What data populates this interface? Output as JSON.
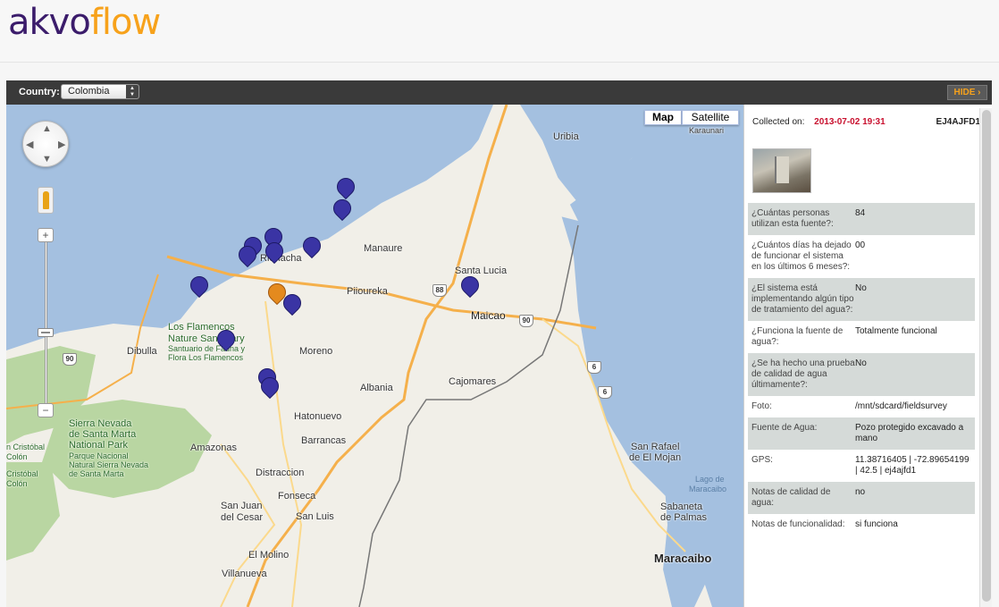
{
  "logo": {
    "part1": "akvo",
    "part2": "flow"
  },
  "toolbar": {
    "country_label": "Country:",
    "country_value": "Colombia",
    "hide_label": "HIDE ›"
  },
  "map": {
    "map_button": "Map",
    "satellite_button": "Satellite",
    "zoom_in": "+",
    "zoom_out": "−",
    "labels": {
      "uribia": "Uribia",
      "karaunari": "Karaunari",
      "manaure": "Manaure",
      "santa_lucia": "Santa Lucia",
      "riohacha": "Riohacha",
      "piioreka": "Piioureka",
      "maicao": "Maicao",
      "moreno": "Moreno",
      "dibulla": "Dibulla",
      "flamencos1": "Los Flamencos",
      "flamencos2": "Nature Sanctuary",
      "flamencos3": "Santuario de Fauna y",
      "flamencos4": "Flora Los Flamencos",
      "cajomares": "Cajomares",
      "albania": "Albania",
      "hatonuevo": "Hatonuevo",
      "barrancas": "Barrancas",
      "amazonas": "Amazonas",
      "sierra1": "Sierra Nevada",
      "sierra2": "de Santa Marta",
      "sierra3": "National Park",
      "sierra4": "Parque Nacional",
      "sierra5": "Natural Sierra Nevada",
      "sierra6": "de Santa Marta",
      "cristobal1": "n Cristóbal",
      "cristobal2": "Colón",
      "cristobal3": "Cristóbal",
      "cristobal4": "Colón",
      "distraccion": "Distraccion",
      "fonseca": "Fonseca",
      "sanjuan1": "San Juan",
      "sanjuan2": "del Cesar",
      "sanluis": "San Luis",
      "elmolino": "El Molino",
      "villanueva": "Villanueva",
      "sanrafael1": "San Rafael",
      "sanrafael2": "de El Mojan",
      "lago1": "Lago de",
      "lago2": "Maracaibo",
      "sabaneta1": "Sabaneta",
      "sabaneta2": "de Palmas",
      "maracaibo": "Maracaibo"
    },
    "shields": {
      "s88": "88",
      "s90a": "90",
      "s90b": "90",
      "s6a": "6",
      "s6b": "6"
    }
  },
  "panel": {
    "collected_label": "Collected on:",
    "collected_date": "2013-07-02 19:31",
    "code": "EJ4AJFD1",
    "rows": [
      {
        "q": "¿Cuántas personas utilizan esta fuente?:",
        "a": "84"
      },
      {
        "q": "¿Cuántos días ha dejado de funcionar el sistema en los últimos 6 meses?:",
        "a": "00"
      },
      {
        "q": "¿El sistema está implementando algún tipo de tratamiento del agua?:",
        "a": "No"
      },
      {
        "q": "¿Funciona la fuente de agua?:",
        "a": "Totalmente funcional"
      },
      {
        "q": "¿Se ha hecho una prueba de calidad de agua últimamente?:",
        "a": "No"
      },
      {
        "q": "Foto:",
        "a": "/mnt/sdcard/fieldsurvey"
      },
      {
        "q": "Fuente de Agua:",
        "a": "Pozo protegido excavado a mano"
      },
      {
        "q": "GPS:",
        "a": "11.38716405 | -72.89654199 | 42.5 | ej4ajfd1"
      },
      {
        "q": "Notas de calidad de agua:",
        "a": "no"
      },
      {
        "q": "Notas de funcionalidad:",
        "a": "si funciona"
      }
    ]
  }
}
